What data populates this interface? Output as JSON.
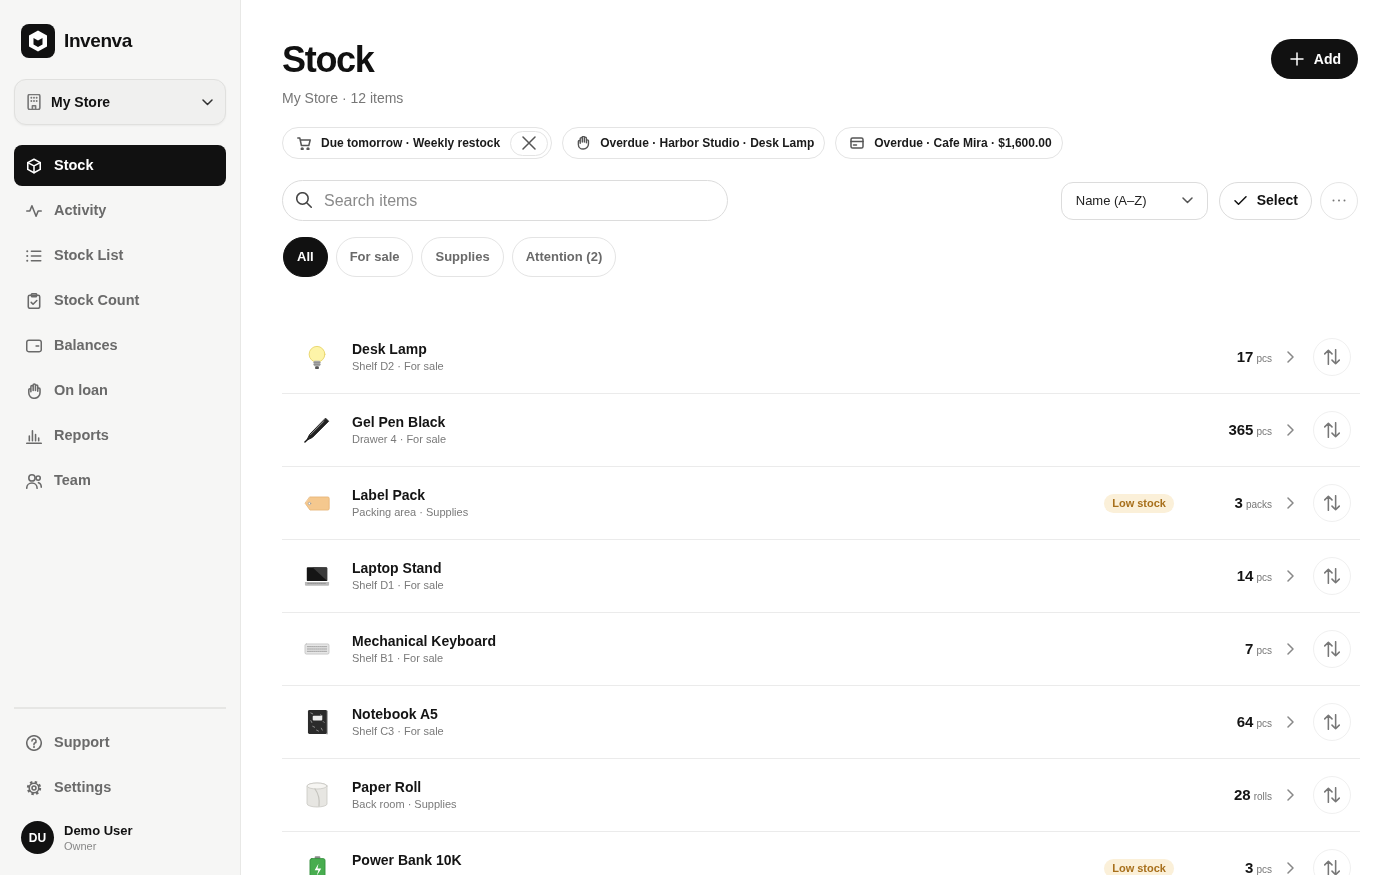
{
  "sidebar": {
    "brand": "Invenva",
    "store": "My Store",
    "nav": [
      {
        "label": "Stock",
        "selected": true
      },
      {
        "label": "Activity",
        "selected": false
      },
      {
        "label": "Stock List",
        "selected": false
      },
      {
        "label": "Stock Count",
        "selected": false
      },
      {
        "label": "Balances",
        "selected": false
      },
      {
        "label": "On loan",
        "selected": false
      },
      {
        "label": "Reports",
        "selected": false
      },
      {
        "label": "Team",
        "selected": false
      }
    ],
    "footer_nav": [
      {
        "label": "Support",
        "selected": false
      },
      {
        "label": "Settings",
        "selected": false
      }
    ],
    "user": {
      "initials": "DU",
      "name": "Demo User",
      "role": "Owner"
    }
  },
  "header": {
    "title": "Stock",
    "subtitle": "My Store · 12 items",
    "add_button": "Add"
  },
  "alerts": [
    {
      "text": "Due tomorrow · Weekly restock",
      "dismissible": true
    },
    {
      "text": "Overdue · Harbor Studio · Desk Lamp",
      "dismissible": false
    },
    {
      "text": "Overdue · Cafe Mira · $1,600.00",
      "dismissible": false
    }
  ],
  "toolbar": {
    "search": {
      "placeholder": "Search items"
    },
    "sort": "Name (A–Z)",
    "select_button": "Select"
  },
  "filters": [
    {
      "label": "All",
      "selected": true
    },
    {
      "label": "For sale",
      "selected": false
    },
    {
      "label": "Supplies",
      "selected": false
    },
    {
      "label": "Attention (2)",
      "selected": false
    }
  ],
  "items": [
    {
      "name": "Desk Lamp",
      "details": "Shelf D2 · For sale",
      "quantity": "17",
      "unit": "pcs"
    },
    {
      "name": "Gel Pen Black",
      "details": "Drawer 4 · For sale",
      "quantity": "365",
      "unit": "pcs"
    },
    {
      "name": "Label Pack",
      "details": "Packing area · Supplies",
      "badge": "Low stock",
      "quantity": "3",
      "unit": "packs"
    },
    {
      "name": "Laptop Stand",
      "details": "Shelf D1 · For sale",
      "quantity": "14",
      "unit": "pcs"
    },
    {
      "name": "Mechanical Keyboard",
      "details": "Shelf B1 · For sale",
      "quantity": "7",
      "unit": "pcs"
    },
    {
      "name": "Notebook A5",
      "details": "Shelf C3 · For sale",
      "quantity": "64",
      "unit": "pcs"
    },
    {
      "name": "Paper Roll",
      "details": "Back room · Supplies",
      "quantity": "28",
      "unit": "rolls"
    },
    {
      "name": "Power Bank 10K",
      "badge": "Low stock",
      "quantity": "3",
      "unit": "pcs"
    }
  ]
}
